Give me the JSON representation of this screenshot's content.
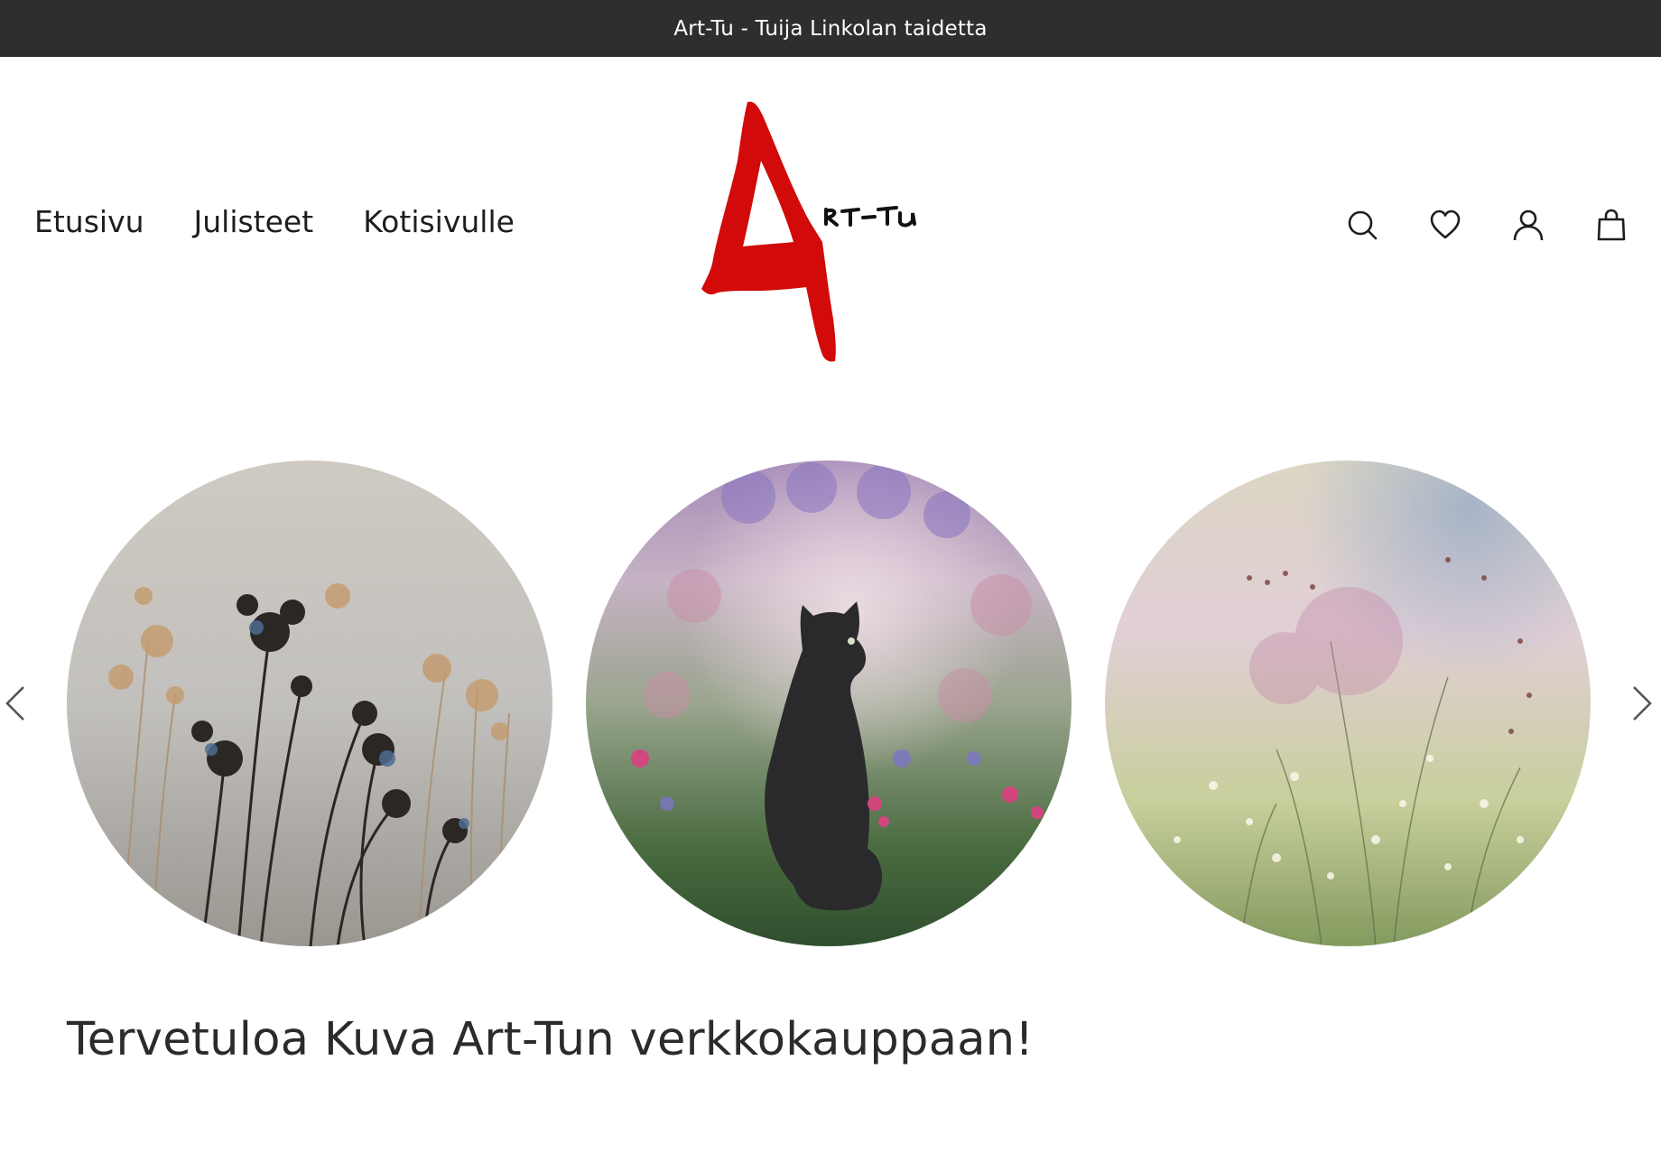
{
  "announcement": {
    "text": "Art-Tu - Tuija Linkolan taidetta"
  },
  "nav": {
    "items": [
      {
        "label": "Etusivu"
      },
      {
        "label": "Julisteet"
      },
      {
        "label": "Kotisivulle"
      }
    ]
  },
  "logo": {
    "text": "Art-Tu",
    "accent_color": "#d20a0a"
  },
  "header_icons": [
    "search-icon",
    "heart-icon",
    "user-icon",
    "bag-icon"
  ],
  "carousel": {
    "slides": [
      {
        "subject": "dried flowers painting"
      },
      {
        "subject": "black cat in meadow painting"
      },
      {
        "subject": "pastel meadow grass painting"
      }
    ],
    "prev_icon": "chevron-left-icon",
    "next_icon": "chevron-right-icon"
  },
  "welcome": {
    "heading": "Tervetuloa Kuva Art-Tun verkkokauppaan!"
  },
  "colors": {
    "topbar_bg": "#2e2e2e",
    "topbar_text": "#ffffff",
    "text": "#1e1e1e"
  }
}
